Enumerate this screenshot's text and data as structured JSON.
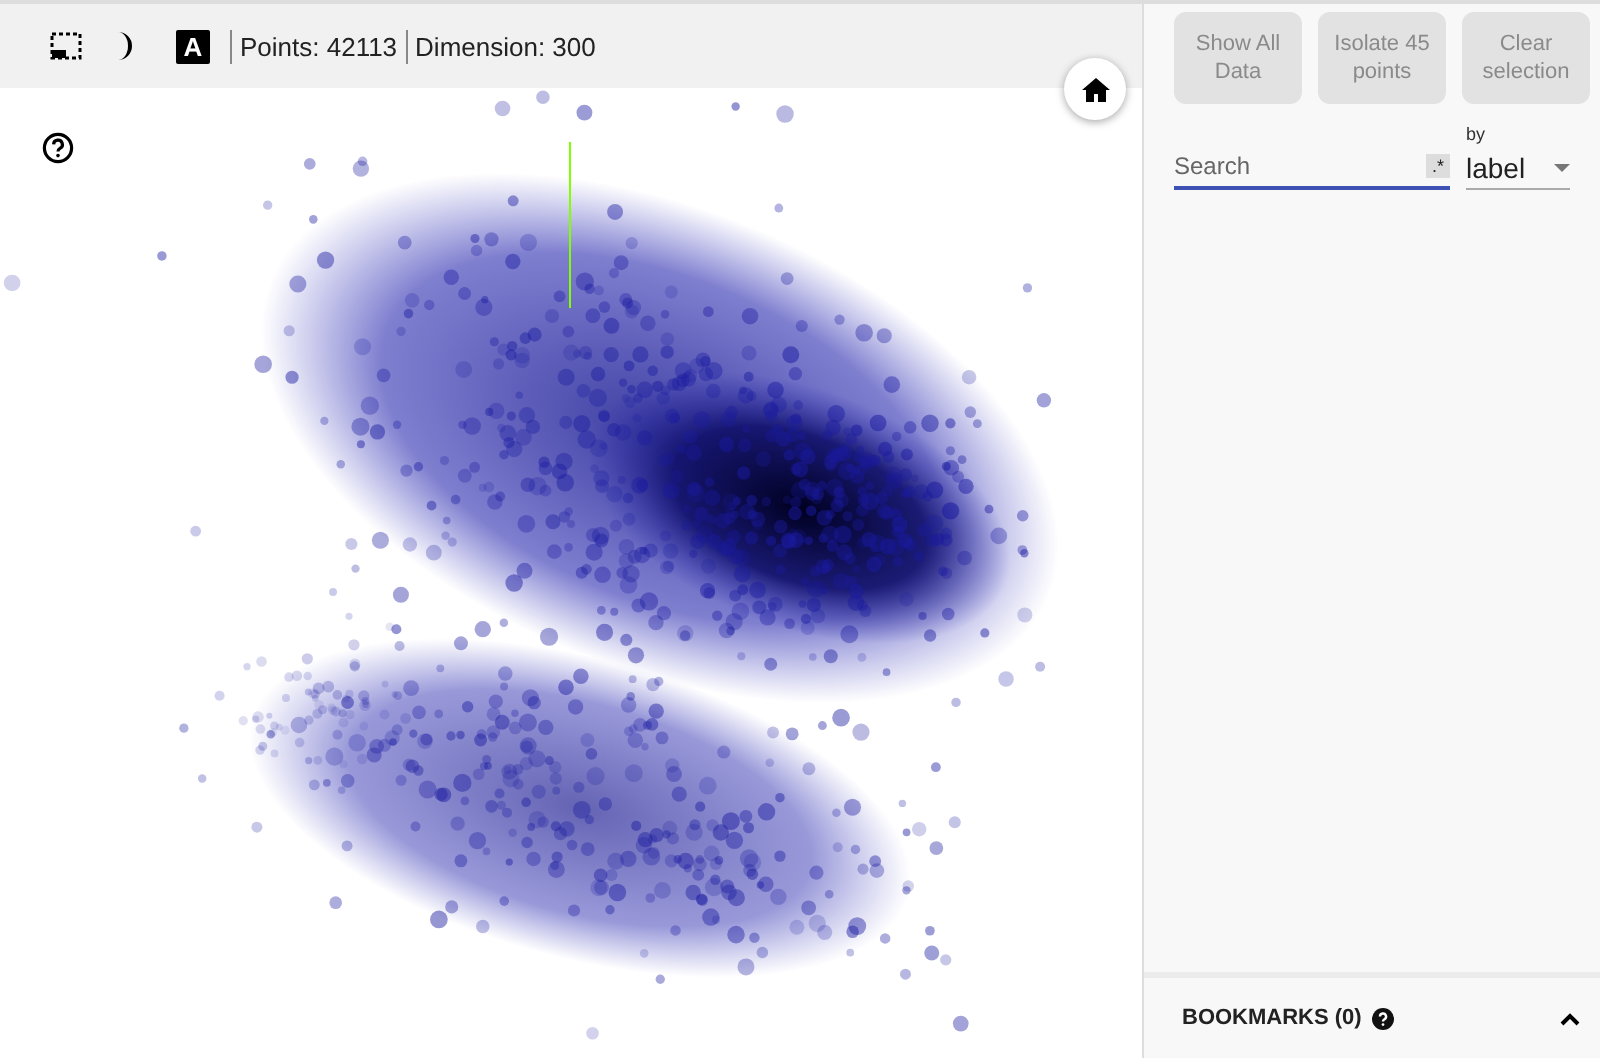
{
  "toolbar": {
    "points": "Points: 42113",
    "dimension": "Dimension: 300",
    "label_icon_text": "A"
  },
  "actions": [
    {
      "label": "Show All Data",
      "disabled": true
    },
    {
      "label": "Isolate 45 points",
      "disabled": true
    },
    {
      "label": "Clear selection",
      "disabled": true
    }
  ],
  "search": {
    "placeholder": "Search",
    "regex_toggle": ".*",
    "by_label": "by",
    "by_value": "label"
  },
  "bookmarks": {
    "title": "BOOKMARKS (0)",
    "expanded": false
  }
}
